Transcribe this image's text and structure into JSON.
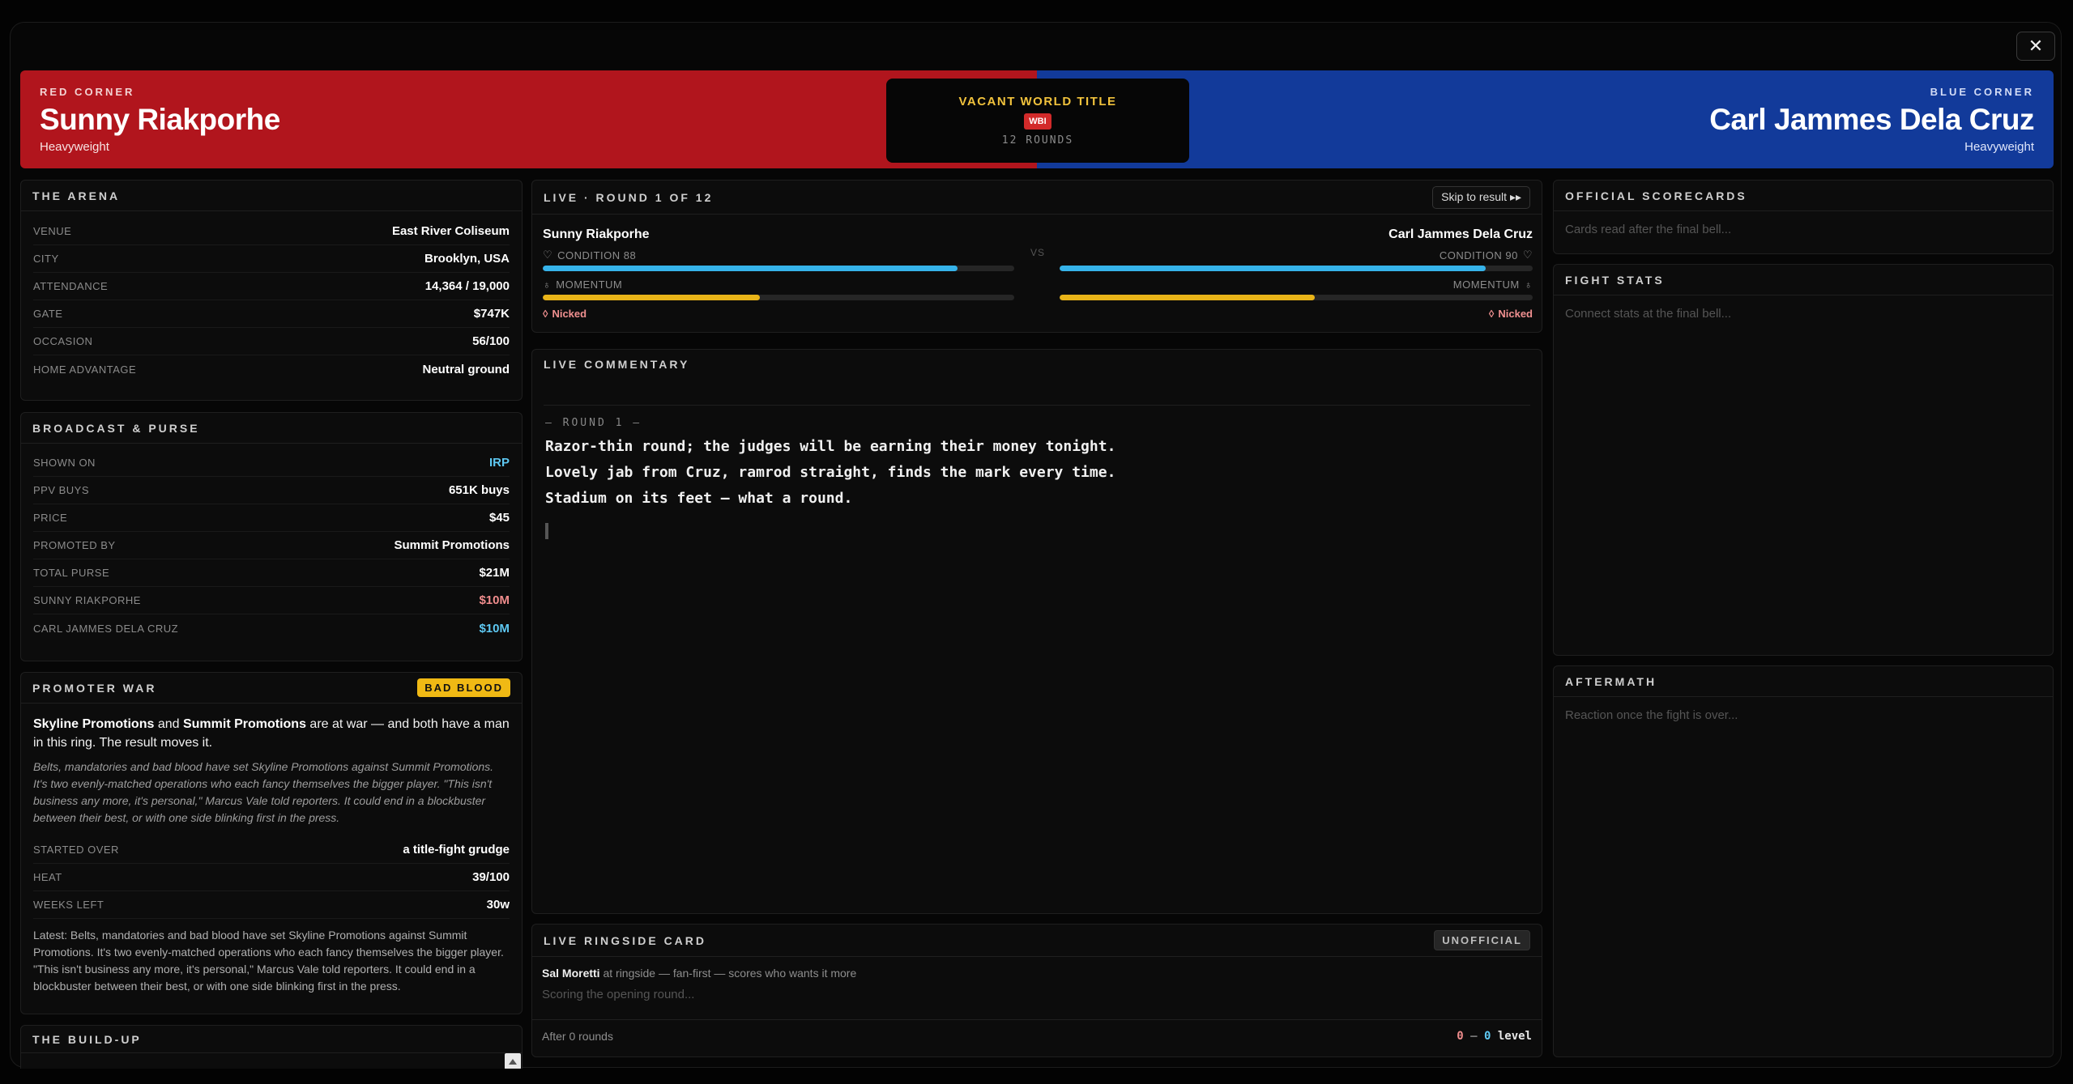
{
  "hero": {
    "red": {
      "tag": "RED CORNER",
      "name": "Sunny Riakporhe",
      "weight": "Heavyweight"
    },
    "blue": {
      "tag": "BLUE CORNER",
      "name": "Carl Jammes Dela Cruz",
      "weight": "Heavyweight"
    },
    "title": "VACANT WORLD TITLE",
    "belt": "WBI",
    "rounds": "12 ROUNDS"
  },
  "arena": {
    "title": "THE ARENA",
    "rows": [
      {
        "k": "VENUE",
        "v": "East River Coliseum"
      },
      {
        "k": "CITY",
        "v": "Brooklyn, USA"
      },
      {
        "k": "ATTENDANCE",
        "v": "14,364 / 19,000"
      },
      {
        "k": "GATE",
        "v": "$747K"
      },
      {
        "k": "OCCASION",
        "v": "56/100"
      },
      {
        "k": "HOME ADVANTAGE",
        "v": "Neutral ground"
      }
    ]
  },
  "broadcast": {
    "title": "BROADCAST & PURSE",
    "rows": [
      {
        "k": "SHOWN ON",
        "v": "IRP"
      },
      {
        "k": "PPV BUYS",
        "v": "651K buys"
      },
      {
        "k": "PRICE",
        "v": "$45"
      },
      {
        "k": "PROMOTED BY",
        "v": "Summit Promotions"
      },
      {
        "k": "TOTAL PURSE",
        "v": "$21M"
      },
      {
        "k": "SUNNY RIAKPORHE",
        "v": "$10M"
      },
      {
        "k": "CARL JAMMES DELA CRUZ",
        "v": "$10M"
      }
    ]
  },
  "promoter": {
    "title": "PROMOTER WAR",
    "badge": "BAD BLOOD",
    "lead_a": "Skyline Promotions",
    "lead_and": " and ",
    "lead_b": "Summit Promotions",
    "lead_rest": " are at war — and both have a man in this ring. The result moves it.",
    "italic": "Belts, mandatories and bad blood have set Skyline Promotions against Summit Promotions. It's two evenly-matched operations who each fancy themselves the bigger player. \"This isn't business any more, it's personal,\" Marcus Vale told reporters. It could end in a blockbuster between their best, or with one side blinking first in the press.",
    "rows": [
      {
        "k": "STARTED OVER",
        "v": "a title-fight grudge"
      },
      {
        "k": "HEAT",
        "v": "39/100"
      },
      {
        "k": "WEEKS LEFT",
        "v": "30w"
      }
    ],
    "latest": "Latest: Belts, mandatories and bad blood have set Skyline Promotions against Summit Promotions. It's two evenly-matched operations who each fancy themselves the bigger player. \"This isn't business any more, it's personal,\" Marcus Vale told reporters. It could end in a blockbuster between their best, or with one side blinking first in the press."
  },
  "buildup": {
    "title": "THE BUILD-UP"
  },
  "live": {
    "title": "LIVE · ROUND 1 OF 12",
    "skip": "Skip to result ▸▸",
    "vs": "VS",
    "left": {
      "name": "Sunny Riakporhe",
      "condition": "CONDITION 88",
      "condition_value": 88,
      "momentum": "MOMENTUM",
      "momentum_value": 46,
      "status": "Nicked"
    },
    "right": {
      "name": "Carl Jammes Dela Cruz",
      "condition": "CONDITION 90",
      "condition_value": 90,
      "momentum": "MOMENTUM",
      "momentum_value": 54,
      "status": "Nicked"
    },
    "colors": {
      "condition": "#36b3ea",
      "momentum": "#e9b418"
    }
  },
  "commentary": {
    "title": "LIVE COMMENTARY",
    "round_marker": "— ROUND 1 —",
    "lines": [
      "Razor-thin round; the judges will be earning their money tonight.",
      "Lovely jab from Cruz, ramrod straight, finds the mark every time.",
      "Stadium on its feet — what a round."
    ]
  },
  "ringside": {
    "title": "LIVE RINGSIDE CARD",
    "badge": "UNOFFICIAL",
    "judge": "Sal Moretti",
    "judge_desc": " at ringside — fan-first — scores who wants it more",
    "placeholder": "Scoring the opening round...",
    "after": "After 0 rounds",
    "score_red": "0",
    "score_sep": " – ",
    "score_blue": "0",
    "score_word": "level"
  },
  "scorecards": {
    "title": "OFFICIAL SCORECARDS",
    "placeholder": "Cards read after the final bell..."
  },
  "fightstats": {
    "title": "FIGHT STATS",
    "placeholder": "Connect stats at the final bell..."
  },
  "aftermath": {
    "title": "AFTERMATH",
    "placeholder": "Reaction once the fight is over..."
  },
  "colors": {
    "red": "#b1151d",
    "blue": "#123a9a",
    "gold": "#f1c23c",
    "cyan": "#5ec8f2",
    "pink": "#f08d8d"
  }
}
